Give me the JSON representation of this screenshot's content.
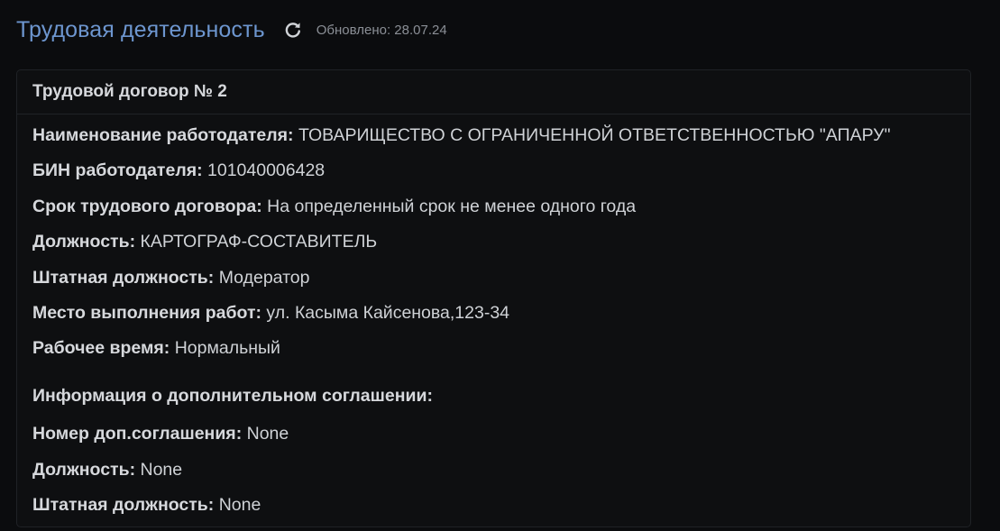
{
  "header": {
    "title": "Трудовая деятельность",
    "refresh_icon": "refresh-icon",
    "updated": "Обновлено: 28.07.24"
  },
  "contract": {
    "title": "Трудовой договор № 2",
    "fields": [
      {
        "label": "Наименование работодателя:",
        "value": " ТОВАРИЩЕСТВО С ОГРАНИЧЕННОЙ ОТВЕТСТВЕННОСТЬЮ \"АПАРУ\""
      },
      {
        "label": "БИН работодателя:",
        "value": " 101040006428"
      },
      {
        "label": "Срок трудового договора:",
        "value": " На определенный срок не менее одного года"
      },
      {
        "label": "Должность:",
        "value": " КАРТОГРАФ-СОСТАВИТЕЛЬ"
      },
      {
        "label": "Штатная должность:",
        "value": " Модератор"
      },
      {
        "label": "Место выполнения работ:",
        "value": " ул. Касыма Кайсенова,123-34"
      },
      {
        "label": "Рабочее время:",
        "value": " Нормальный"
      }
    ],
    "additional": {
      "title": "Информация о дополнительном соглашении:",
      "fields": [
        {
          "label": "Номер доп.соглашения:",
          "value": " None"
        },
        {
          "label": "Должность:",
          "value": " None"
        },
        {
          "label": "Штатная должность:",
          "value": " None"
        }
      ]
    }
  },
  "colors": {
    "background": "#0b0c0e",
    "title": "#6d96cf",
    "muted": "#8b8f96",
    "text": "#cfd2d6"
  }
}
